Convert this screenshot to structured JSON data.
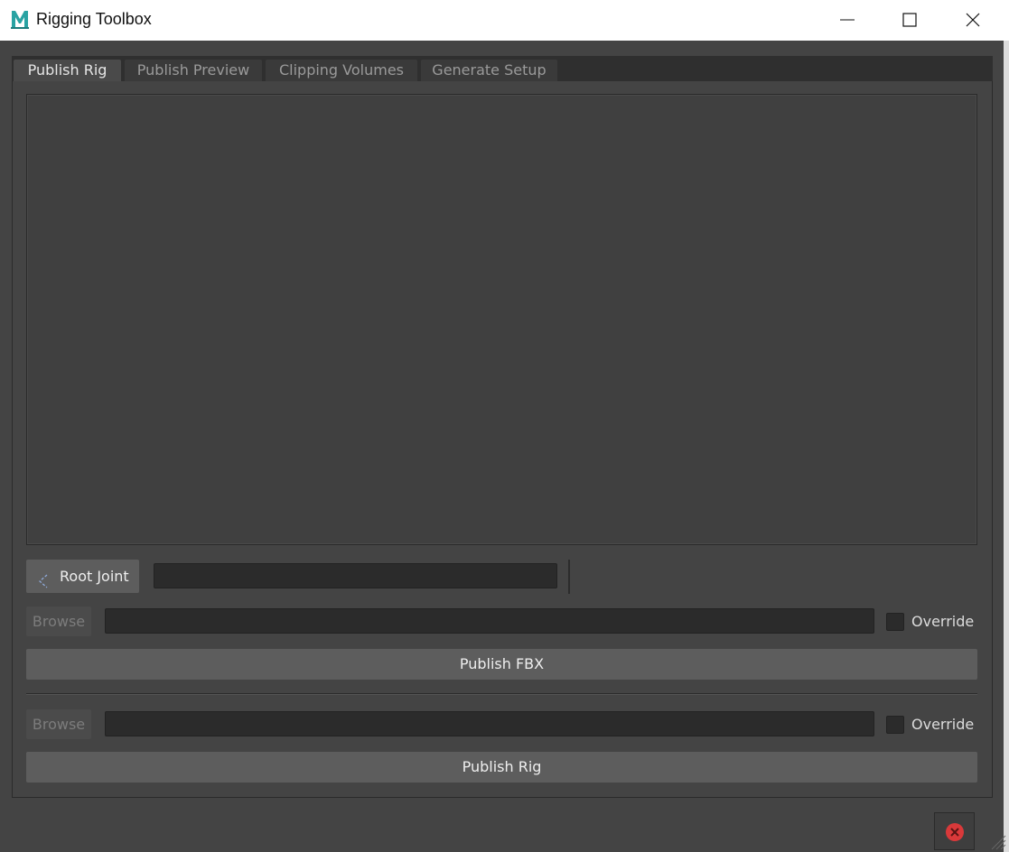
{
  "window": {
    "title": "Rigging Toolbox",
    "icon_letter": "M"
  },
  "tabs": [
    {
      "label": "Publish Rig",
      "active": true
    },
    {
      "label": "Publish Preview",
      "active": false
    },
    {
      "label": "Clipping Volumes",
      "active": false
    },
    {
      "label": "Generate Setup",
      "active": false
    }
  ],
  "publish_rig": {
    "root_joint_button": "Root Joint",
    "root_joint_value": "",
    "fbx_row": {
      "browse_label": "Browse",
      "path_value": "",
      "override_label": "Override",
      "override_checked": false
    },
    "publish_fbx_label": "Publish FBX",
    "rig_row": {
      "browse_label": "Browse",
      "path_value": "",
      "override_label": "Override",
      "override_checked": false
    },
    "publish_rig_label": "Publish Rig"
  },
  "icons": {
    "app": "maya-app-icon",
    "root_joint": "joint-arrow-icon",
    "stop": "stop-close-icon"
  },
  "colors": {
    "background": "#444444",
    "accent_teal": "#29a3a3",
    "stop_red": "#d9393a"
  }
}
